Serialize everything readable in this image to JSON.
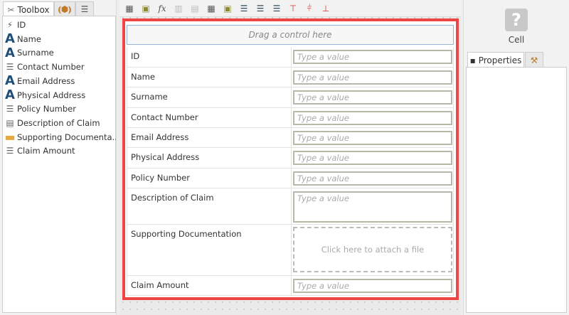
{
  "toolbox": {
    "tabs": [
      {
        "label": "Toolbox"
      },
      {
        "label": ""
      },
      {
        "label": ""
      }
    ],
    "items": [
      {
        "label": "ID",
        "icon": "autonumber-icon"
      },
      {
        "label": "Name",
        "icon": "text-icon"
      },
      {
        "label": "Surname",
        "icon": "text-icon"
      },
      {
        "label": "Contact Number",
        "icon": "number-icon"
      },
      {
        "label": "Email Address",
        "icon": "text-icon"
      },
      {
        "label": "Physical Address",
        "icon": "text-icon"
      },
      {
        "label": "Policy Number",
        "icon": "number-icon"
      },
      {
        "label": "Description of Claim",
        "icon": "memo-icon"
      },
      {
        "label": "Supporting Documenta...",
        "icon": "folder-icon"
      },
      {
        "label": "Claim Amount",
        "icon": "number-icon"
      }
    ]
  },
  "toolbar": {
    "fx_label": "fx"
  },
  "canvas": {
    "drag_placeholder": "Drag a control here",
    "input_placeholder": "Type a value",
    "attach_text": "Click here to attach a file",
    "rows": [
      {
        "label": "ID"
      },
      {
        "label": "Name"
      },
      {
        "label": "Surname"
      },
      {
        "label": "Contact Number"
      },
      {
        "label": "Email Address"
      },
      {
        "label": "Physical Address"
      },
      {
        "label": "Policy Number"
      },
      {
        "label": "Description of Claim"
      },
      {
        "label": "Supporting Documentation"
      },
      {
        "label": "Claim Amount"
      }
    ]
  },
  "right": {
    "selected_type": "Cell",
    "icon_glyph": "?",
    "tabs": [
      {
        "label": "Properties"
      }
    ]
  },
  "colors": {
    "frame": "#f04545",
    "accent": "#1f4e79"
  }
}
